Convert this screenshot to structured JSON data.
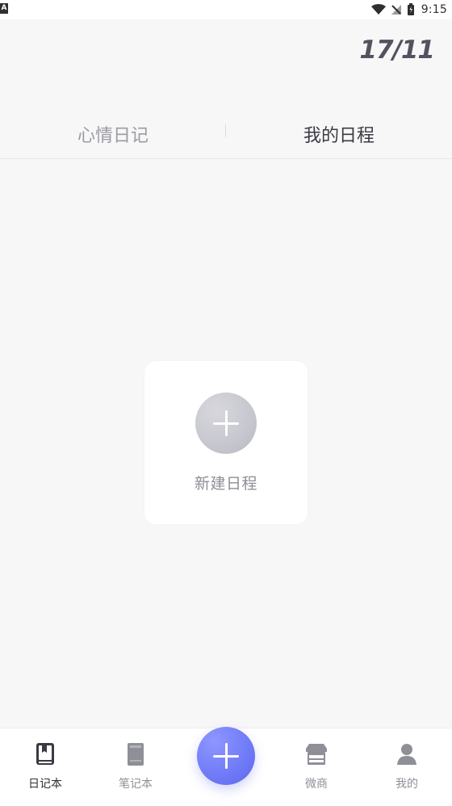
{
  "status_bar": {
    "left_badge": "A",
    "time": "9:15",
    "icons": [
      "wifi-icon",
      "signal-off-icon",
      "battery-icon"
    ]
  },
  "header": {
    "date": "17/11",
    "tabs": [
      {
        "label": "心情日记",
        "active": false
      },
      {
        "label": "我的日程",
        "active": true
      }
    ]
  },
  "main": {
    "new_schedule_label": "新建日程"
  },
  "bottom_nav": {
    "items": [
      {
        "label": "日记本",
        "icon": "diary-book-icon",
        "active": true
      },
      {
        "label": "笔记本",
        "icon": "notebook-icon",
        "active": false
      },
      {
        "label": "",
        "icon": "plus-icon",
        "active": false
      },
      {
        "label": "微商",
        "icon": "store-icon",
        "active": false
      },
      {
        "label": "我的",
        "icon": "user-icon",
        "active": false
      }
    ]
  },
  "colors": {
    "background": "#f7f7f8",
    "card": "#ffffff",
    "accent": "#6f79f6",
    "active_text": "#3a3a44",
    "inactive_text": "#9b9ba4"
  }
}
